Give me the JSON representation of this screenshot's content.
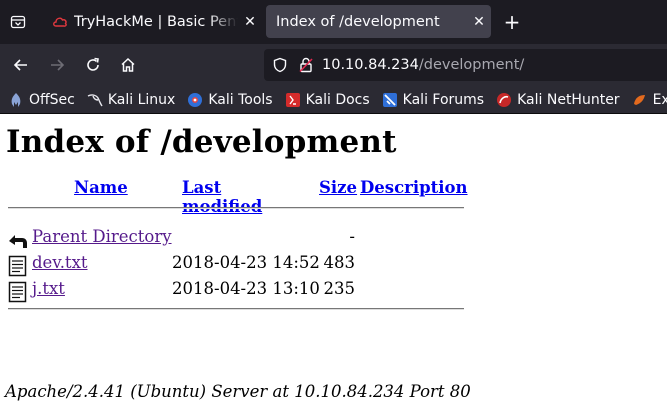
{
  "browser": {
    "tabs": [
      {
        "title": "TryHackMe | Basic Pentesting",
        "active": false
      },
      {
        "title": "Index of /development",
        "active": true
      }
    ],
    "close_glyph": "✕",
    "new_tab_glyph": "+",
    "url": {
      "host": "10.10.84.234",
      "path": "/development/"
    },
    "bookmarks": [
      {
        "label": "OffSec",
        "icon": "offsec-icon"
      },
      {
        "label": "Kali Linux",
        "icon": "kali-dragon-icon"
      },
      {
        "label": "Kali Tools",
        "icon": "kali-tools-icon"
      },
      {
        "label": "Kali Docs",
        "icon": "kali-docs-icon"
      },
      {
        "label": "Kali Forums",
        "icon": "kali-forums-icon"
      },
      {
        "label": "Kali NetHunter",
        "icon": "nethunter-icon"
      },
      {
        "label": "Exploit",
        "icon": "exploit-db-icon"
      }
    ]
  },
  "page": {
    "heading": "Index of /development",
    "columns": {
      "name": "Name",
      "modified": "Last modified",
      "size": "Size",
      "description": "Description"
    },
    "parent": {
      "label": "Parent Directory",
      "size": "-"
    },
    "files": [
      {
        "name": "dev.txt",
        "modified": "2018-04-23 14:52",
        "size": "483"
      },
      {
        "name": "j.txt",
        "modified": "2018-04-23 13:10",
        "size": "235"
      }
    ],
    "footer": "Apache/2.4.41 (Ubuntu) Server at 10.10.84.234 Port 80"
  }
}
